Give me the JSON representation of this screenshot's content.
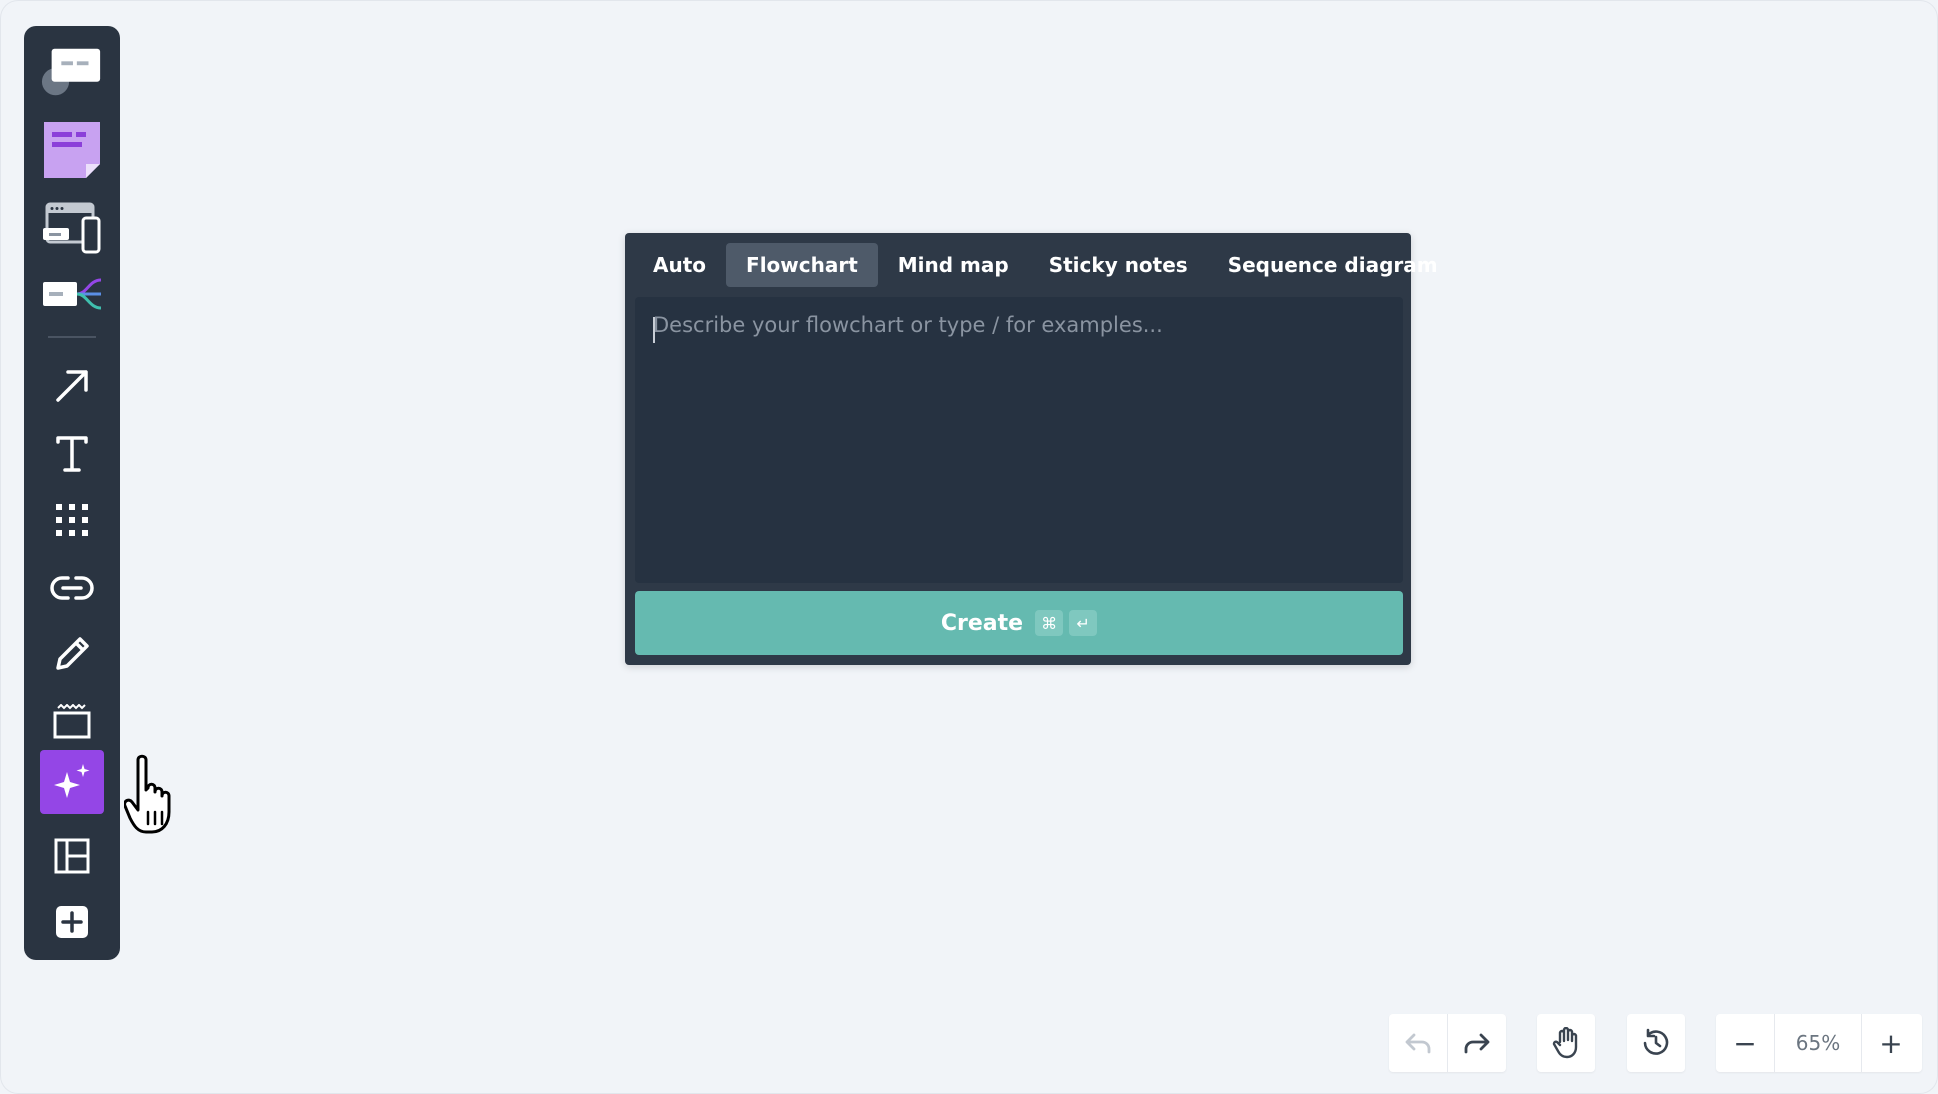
{
  "toolbar": {
    "tools": [
      {
        "name": "comment-card-icon"
      },
      {
        "name": "sticky-note-icon"
      },
      {
        "name": "devices-wireframe-icon"
      },
      {
        "name": "card-connector-icon"
      },
      {
        "name": "arrow-icon"
      },
      {
        "name": "text-icon"
      },
      {
        "name": "grid-icon"
      },
      {
        "name": "link-icon"
      },
      {
        "name": "pencil-icon"
      },
      {
        "name": "frame-icon"
      },
      {
        "name": "ai-sparkle-icon",
        "active": true
      },
      {
        "name": "layout-icon"
      },
      {
        "name": "add-icon"
      }
    ],
    "active_color": "#9446e6"
  },
  "dialog": {
    "tabs": [
      {
        "label": "Auto"
      },
      {
        "label": "Flowchart",
        "active": true
      },
      {
        "label": "Mind map"
      },
      {
        "label": "Sticky notes"
      },
      {
        "label": "Sequence diagram"
      }
    ],
    "prompt": {
      "value": "",
      "placeholder": "Describe your flowchart or type / for examples..."
    },
    "create": {
      "label": "Create",
      "shortcut_cmd": "⌘",
      "shortcut_enter": "↵",
      "color": "#65bab0"
    }
  },
  "bottom_controls": {
    "undo": "undo-icon",
    "redo": "redo-icon",
    "pan": "hand-icon",
    "history": "history-icon",
    "zoom_out": "−",
    "zoom": "65%",
    "zoom_in": "+"
  }
}
